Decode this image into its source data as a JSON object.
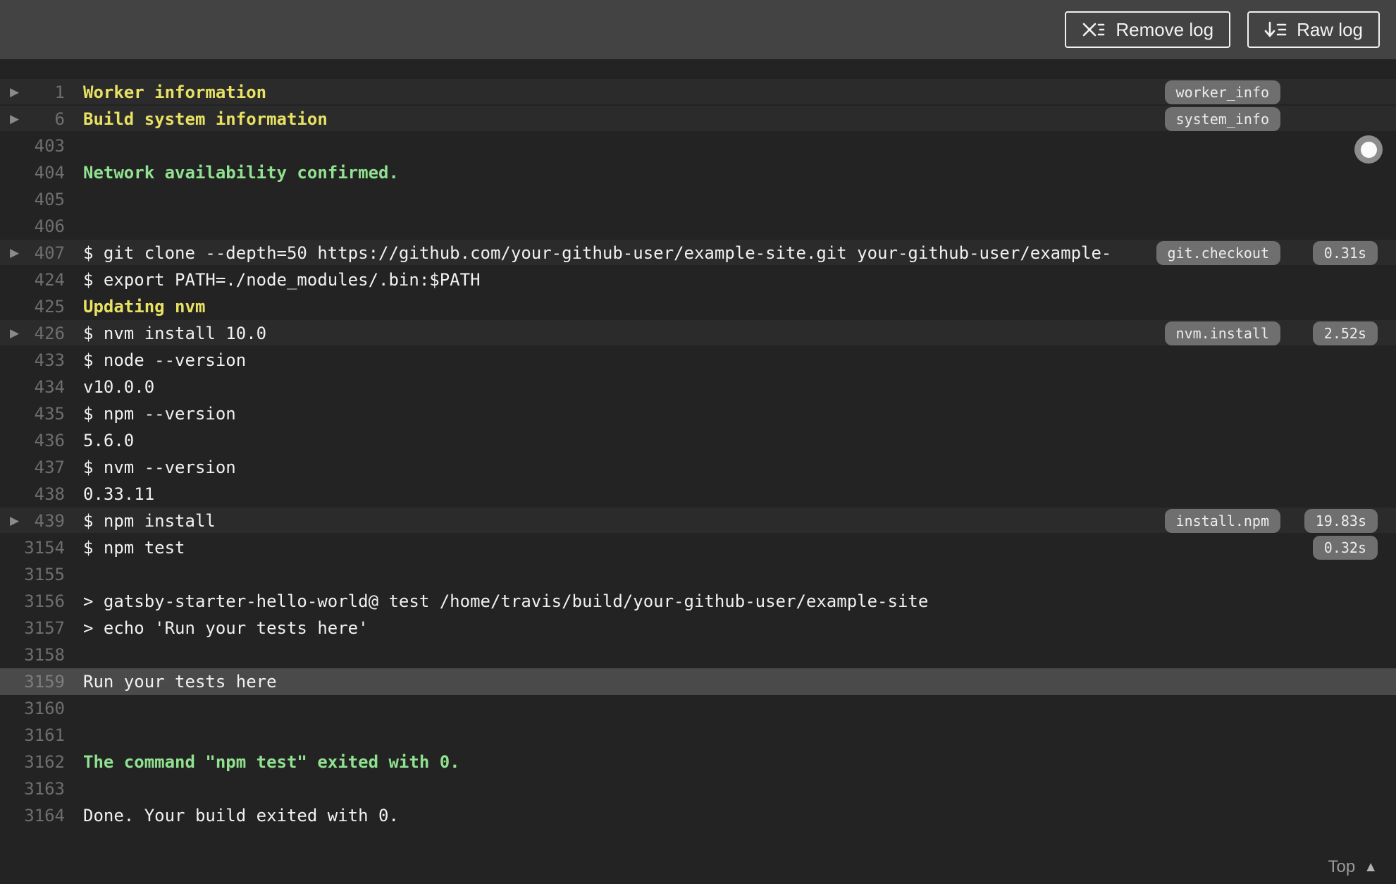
{
  "toolbar": {
    "remove_log_label": "Remove log",
    "raw_log_label": "Raw log"
  },
  "colors": {
    "topbar_bg": "#434343",
    "log_bg": "#232323",
    "fold_row_bg": "#2b2b2b",
    "highlight_row_bg": "#4a4a4a",
    "text": "#f1f1f1",
    "line_number": "#6e6e6e",
    "fold_title": "#e8e163",
    "success": "#90e190",
    "badge_bg": "#6f6f6f",
    "badge_text": "#ececec",
    "arrow": "#8a8a8a",
    "footer_text": "#9a9a9a"
  },
  "log": {
    "rows": [
      {
        "n": "1",
        "text": "Worker information",
        "style": "title",
        "fold": true,
        "badge": "worker_info"
      },
      {
        "n": "6",
        "text": "Build system information",
        "style": "title",
        "fold": true,
        "badge": "system_info"
      },
      {
        "n": "403",
        "text": ""
      },
      {
        "n": "404",
        "text": "Network availability confirmed.",
        "style": "success"
      },
      {
        "n": "405",
        "text": ""
      },
      {
        "n": "406",
        "text": ""
      },
      {
        "n": "407",
        "text": "$ git clone --depth=50 https://github.com/your-github-user/example-site.git your-github-user/example-",
        "fold": true,
        "badge": "git.checkout",
        "time": "0.31s"
      },
      {
        "n": "424",
        "text": "$ export PATH=./node_modules/.bin:$PATH"
      },
      {
        "n": "425",
        "text": "Updating nvm",
        "style": "title"
      },
      {
        "n": "426",
        "text": "$ nvm install 10.0",
        "fold": true,
        "badge": "nvm.install",
        "time": "2.52s"
      },
      {
        "n": "433",
        "text": "$ node --version"
      },
      {
        "n": "434",
        "text": "v10.0.0"
      },
      {
        "n": "435",
        "text": "$ npm --version"
      },
      {
        "n": "436",
        "text": "5.6.0"
      },
      {
        "n": "437",
        "text": "$ nvm --version"
      },
      {
        "n": "438",
        "text": "0.33.11"
      },
      {
        "n": "439",
        "text": "$ npm install",
        "fold": true,
        "badge": "install.npm",
        "time": "19.83s"
      },
      {
        "n": "3154",
        "text": "$ npm test",
        "time": "0.32s"
      },
      {
        "n": "3155",
        "text": ""
      },
      {
        "n": "3156",
        "text": "> gatsby-starter-hello-world@ test /home/travis/build/your-github-user/example-site"
      },
      {
        "n": "3157",
        "text": "> echo 'Run your tests here'"
      },
      {
        "n": "3158",
        "text": ""
      },
      {
        "n": "3159",
        "text": "Run your tests here",
        "highlight": true
      },
      {
        "n": "3160",
        "text": ""
      },
      {
        "n": "3161",
        "text": ""
      },
      {
        "n": "3162",
        "text": "The command \"npm test\" exited with 0.",
        "style": "success"
      },
      {
        "n": "3163",
        "text": ""
      },
      {
        "n": "3164",
        "text": "Done. Your build exited with 0."
      }
    ]
  },
  "footer": {
    "top_label": "Top"
  }
}
